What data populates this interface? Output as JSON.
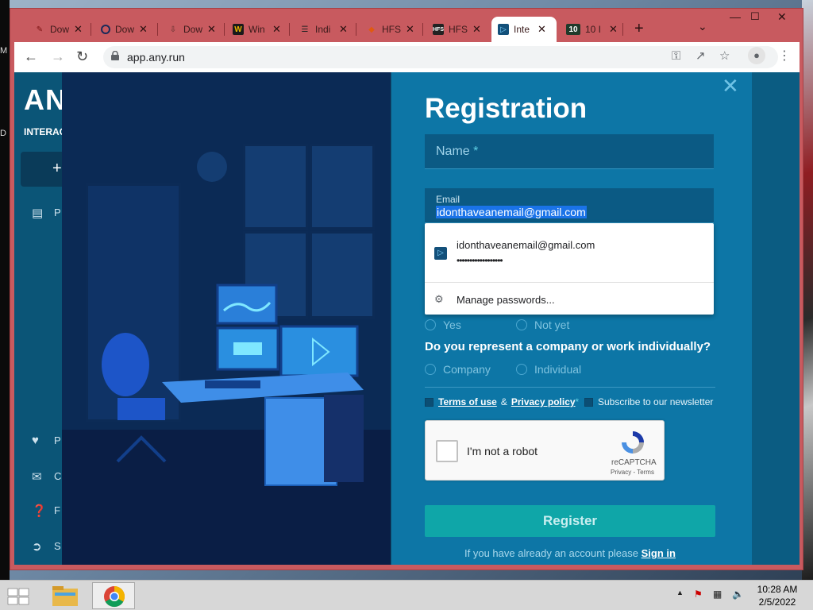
{
  "desktop": {
    "left_chars": [
      "M",
      "D"
    ]
  },
  "browser": {
    "tabs": [
      {
        "title": "Dow",
        "icon": "pdf-icon"
      },
      {
        "title": "Dow",
        "icon": "search-icon"
      },
      {
        "title": "Dow",
        "icon": "download-icon"
      },
      {
        "title": "Win",
        "icon": "w-icon"
      },
      {
        "title": "Indi",
        "icon": "list-icon"
      },
      {
        "title": "HFS",
        "icon": "hfs-icon"
      },
      {
        "title": "HFS",
        "icon": "hfs-icon"
      },
      {
        "title": "Inte",
        "icon": "anyrun-icon",
        "active": true
      },
      {
        "title": "10 I",
        "icon": "ten-icon"
      }
    ],
    "new_tab": "+",
    "url": "app.any.run"
  },
  "app": {
    "logo": "ANY",
    "logo_sub": "INTERACT",
    "new_button": "+",
    "side_items": [
      {
        "icon": "document-icon",
        "label": "P"
      },
      {
        "icon": "cart-icon",
        "label": "P"
      },
      {
        "icon": "mail-icon",
        "label": "C"
      },
      {
        "icon": "help-icon",
        "label": "F"
      },
      {
        "icon": "signout-icon",
        "label": "S"
      }
    ]
  },
  "registration": {
    "title": "Registration",
    "name_placeholder": "Name",
    "required_mark": "*",
    "email_label": "Email",
    "email_value": "idonthaveanemail@gmail.com",
    "autofill": {
      "email": "idonthaveanemail@gmail.com",
      "password_dots": "••••••••••••••••••",
      "manage": "Manage passwords..."
    },
    "yes": "Yes",
    "not_yet": "Not yet",
    "question": "Do you represent a company or work individually?",
    "company": "Company",
    "individual": "Individual",
    "terms": "Terms of use",
    "amp": "&",
    "privacy": "Privacy policy",
    "newsletter": "Subscribe to our newsletter",
    "recaptcha": {
      "label": "I'm not a robot",
      "brand": "reCAPTCHA",
      "links": "Privacy - Terms"
    },
    "register": "Register",
    "signin_prompt": "If you have already an account please",
    "signin_link": "Sign in"
  },
  "taskbar": {
    "time": "10:28 AM",
    "date": "2/5/2022"
  },
  "colors": {
    "window_frame": "#c85a5f",
    "panel": "#0d76a6",
    "register_button": "#0fa6a8",
    "selection": "#1a73e8"
  }
}
